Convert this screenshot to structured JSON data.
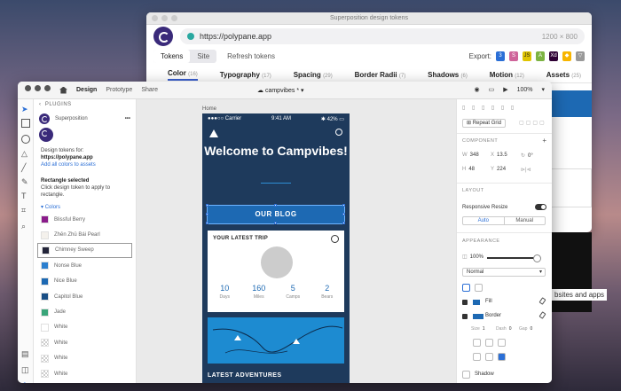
{
  "back_window": {
    "title": "Superposition design tokens",
    "url": "https://polypane.app",
    "viewport": "1200 × 800",
    "mode_tabs": [
      "Tokens",
      "Site"
    ],
    "refresh_label": "Refresh tokens",
    "export_label": "Export:",
    "export_icons": [
      "css-icon",
      "sass-icon",
      "js-icon",
      "android-icon",
      "xd-icon",
      "sketch-icon",
      "figma-icon"
    ],
    "categories": [
      {
        "label": "Color",
        "count": "(16)"
      },
      {
        "label": "Typography",
        "count": "(17)"
      },
      {
        "label": "Spacing",
        "count": "(29)"
      },
      {
        "label": "Border Radii",
        "count": "(7)"
      },
      {
        "label": "Shadows",
        "count": "(6)"
      },
      {
        "label": "Motion",
        "count": "(12)"
      },
      {
        "label": "Assets",
        "count": "(25)"
      }
    ],
    "peek_text": "bsites and apps"
  },
  "front_window": {
    "tabs": [
      "Design",
      "Prototype",
      "Share"
    ],
    "doc_name": "campvibes *",
    "zoom": "100%",
    "plugins_label": "PLUGINS",
    "plugin_name": "Superposition",
    "plugin_desc": "Design tokens for:",
    "plugin_url": "https://polypane.app",
    "add_all": "Add all colors to assets",
    "rect_selected": "Rectangle selected",
    "rect_hint": "Click design token to apply to rectangle.",
    "colors_label": "Colors",
    "swatches": [
      {
        "name": "Blissful Berry",
        "color": "#8b1c8b"
      },
      {
        "name": "Zhēn Zhū Bái Pearl",
        "color": "#f4f1ec"
      },
      {
        "name": "Chimney Sweep",
        "color": "#23253a"
      },
      {
        "name": "Nonse Blue",
        "color": "#2b7fcf"
      },
      {
        "name": "Nice Blue",
        "color": "#1d69b3"
      },
      {
        "name": "Capitol Blue",
        "color": "#1a4f85"
      },
      {
        "name": "Jade",
        "color": "#3aa57a"
      },
      {
        "name": "White",
        "color": "#ffffff"
      },
      {
        "name": "White",
        "color": "#ffffff"
      },
      {
        "name": "White",
        "color": "#ffffff"
      },
      {
        "name": "White",
        "color": "#ffffff"
      }
    ],
    "artboard_label": "Home",
    "phone": {
      "carrier": "●●●○○ Carrier",
      "time": "9:41 AM",
      "battery": "42%",
      "welcome": "Welcome to Campvibes!",
      "blog_button": "OUR BLOG",
      "trip_header": "YOUR LATEST TRIP",
      "stats": [
        {
          "value": "10",
          "label": "Days"
        },
        {
          "value": "160",
          "label": "Miles"
        },
        {
          "value": "5",
          "label": "Camps"
        },
        {
          "value": "2",
          "label": "Bears"
        }
      ],
      "latest": "LATEST ADVENTURES"
    },
    "props": {
      "repeat_grid": "Repeat Grid",
      "component": "COMPONENT",
      "w": "348",
      "x": "13.5",
      "rot": "0°",
      "h": "48",
      "y": "224",
      "layout": "LAYOUT",
      "responsive": "Responsive Resize",
      "auto": "Auto",
      "manual": "Manual",
      "appearance": "APPEARANCE",
      "opacity": "100%",
      "blend": "Normal",
      "fill": "Fill",
      "border": "Border",
      "size_label": "Size",
      "size": "1",
      "dash_label": "Dash",
      "dash": "0",
      "gap_label": "Gap",
      "gap": "0",
      "shadow": "Shadow"
    }
  }
}
